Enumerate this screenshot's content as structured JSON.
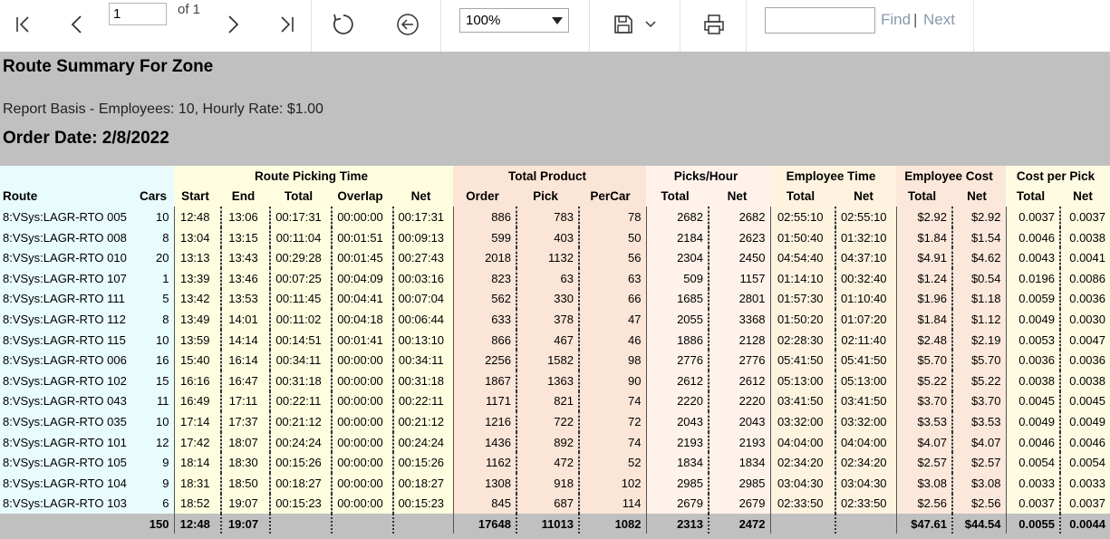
{
  "toolbar": {
    "page_value": "1",
    "of_label": "of 1",
    "zoom_value": "100%",
    "find_placeholder": "",
    "find_label": "Find",
    "separator": "|",
    "next_label": "Next",
    "icons": [
      "first-page-icon",
      "previous-page-icon",
      "next-page-icon",
      "last-page-icon",
      "refresh-icon",
      "back-icon",
      "chevron-down-icon",
      "save-icon",
      "print-icon"
    ]
  },
  "report": {
    "title": "Route Summary For  Zone",
    "basis": "Report Basis - Employees: 10, Hourly Rate: $1.00",
    "order_date": "Order Date: 2/8/2022",
    "group_headers": [
      "Route Picking Time",
      "Total Product",
      "Picks/Hour",
      "Employee Time",
      "Employee Cost",
      "Cost per Pick"
    ],
    "col_headers": [
      "Route",
      "Cars",
      "Start",
      "End",
      "Total",
      "Overlap",
      "Net",
      "Order",
      "Pick",
      "PerCar",
      "Total",
      "Net",
      "Total",
      "Net",
      "Total",
      "Net",
      "Total",
      "Net"
    ],
    "rows": [
      [
        "8:VSys:LAGR-RTO 005",
        "10",
        "12:48",
        "13:06",
        "00:17:31",
        "00:00:00",
        "00:17:31",
        "886",
        "783",
        "78",
        "2682",
        "2682",
        "02:55:10",
        "02:55:10",
        "$2.92",
        "$2.92",
        "0.0037",
        "0.0037"
      ],
      [
        "8:VSys:LAGR-RTO 008",
        "8",
        "13:04",
        "13:15",
        "00:11:04",
        "00:01:51",
        "00:09:13",
        "599",
        "403",
        "50",
        "2184",
        "2623",
        "01:50:40",
        "01:32:10",
        "$1.84",
        "$1.54",
        "0.0046",
        "0.0038"
      ],
      [
        "8:VSys:LAGR-RTO 010",
        "20",
        "13:13",
        "13:43",
        "00:29:28",
        "00:01:45",
        "00:27:43",
        "2018",
        "1132",
        "56",
        "2304",
        "2450",
        "04:54:40",
        "04:37:10",
        "$4.91",
        "$4.62",
        "0.0043",
        "0.0041"
      ],
      [
        "8:VSys:LAGR-RTO 107",
        "1",
        "13:39",
        "13:46",
        "00:07:25",
        "00:04:09",
        "00:03:16",
        "823",
        "63",
        "63",
        "509",
        "1157",
        "01:14:10",
        "00:32:40",
        "$1.24",
        "$0.54",
        "0.0196",
        "0.0086"
      ],
      [
        "8:VSys:LAGR-RTO 111",
        "5",
        "13:42",
        "13:53",
        "00:11:45",
        "00:04:41",
        "00:07:04",
        "562",
        "330",
        "66",
        "1685",
        "2801",
        "01:57:30",
        "01:10:40",
        "$1.96",
        "$1.18",
        "0.0059",
        "0.0036"
      ],
      [
        "8:VSys:LAGR-RTO 112",
        "8",
        "13:49",
        "14:01",
        "00:11:02",
        "00:04:18",
        "00:06:44",
        "633",
        "378",
        "47",
        "2055",
        "3368",
        "01:50:20",
        "01:07:20",
        "$1.84",
        "$1.12",
        "0.0049",
        "0.0030"
      ],
      [
        "8:VSys:LAGR-RTO 115",
        "10",
        "13:59",
        "14:14",
        "00:14:51",
        "00:01:41",
        "00:13:10",
        "866",
        "467",
        "46",
        "1886",
        "2128",
        "02:28:30",
        "02:11:40",
        "$2.48",
        "$2.19",
        "0.0053",
        "0.0047"
      ],
      [
        "8:VSys:LAGR-RTO 006",
        "16",
        "15:40",
        "16:14",
        "00:34:11",
        "00:00:00",
        "00:34:11",
        "2256",
        "1582",
        "98",
        "2776",
        "2776",
        "05:41:50",
        "05:41:50",
        "$5.70",
        "$5.70",
        "0.0036",
        "0.0036"
      ],
      [
        "8:VSys:LAGR-RTO 102",
        "15",
        "16:16",
        "16:47",
        "00:31:18",
        "00:00:00",
        "00:31:18",
        "1867",
        "1363",
        "90",
        "2612",
        "2612",
        "05:13:00",
        "05:13:00",
        "$5.22",
        "$5.22",
        "0.0038",
        "0.0038"
      ],
      [
        "8:VSys:LAGR-RTO 043",
        "11",
        "16:49",
        "17:11",
        "00:22:11",
        "00:00:00",
        "00:22:11",
        "1171",
        "821",
        "74",
        "2220",
        "2220",
        "03:41:50",
        "03:41:50",
        "$3.70",
        "$3.70",
        "0.0045",
        "0.0045"
      ],
      [
        "8:VSys:LAGR-RTO 035",
        "10",
        "17:14",
        "17:37",
        "00:21:12",
        "00:00:00",
        "00:21:12",
        "1216",
        "722",
        "72",
        "2043",
        "2043",
        "03:32:00",
        "03:32:00",
        "$3.53",
        "$3.53",
        "0.0049",
        "0.0049"
      ],
      [
        "8:VSys:LAGR-RTO 101",
        "12",
        "17:42",
        "18:07",
        "00:24:24",
        "00:00:00",
        "00:24:24",
        "1436",
        "892",
        "74",
        "2193",
        "2193",
        "04:04:00",
        "04:04:00",
        "$4.07",
        "$4.07",
        "0.0046",
        "0.0046"
      ],
      [
        "8:VSys:LAGR-RTO 105",
        "9",
        "18:14",
        "18:30",
        "00:15:26",
        "00:00:00",
        "00:15:26",
        "1162",
        "472",
        "52",
        "1834",
        "1834",
        "02:34:20",
        "02:34:20",
        "$2.57",
        "$2.57",
        "0.0054",
        "0.0054"
      ],
      [
        "8:VSys:LAGR-RTO 104",
        "9",
        "18:31",
        "18:50",
        "00:18:27",
        "00:00:00",
        "00:18:27",
        "1308",
        "918",
        "102",
        "2985",
        "2985",
        "03:04:30",
        "03:04:30",
        "$3.08",
        "$3.08",
        "0.0033",
        "0.0033"
      ],
      [
        "8:VSys:LAGR-RTO 103",
        "6",
        "18:52",
        "19:07",
        "00:15:23",
        "00:00:00",
        "00:15:23",
        "845",
        "687",
        "114",
        "2679",
        "2679",
        "02:33:50",
        "02:33:50",
        "$2.56",
        "$2.56",
        "0.0037",
        "0.0037"
      ]
    ],
    "totals": [
      "",
      "150",
      "12:48",
      "19:07",
      "",
      "",
      "",
      "17648",
      "11013",
      "1082",
      "2313",
      "2472",
      "",
      "",
      "$47.61",
      "$44.54",
      "0.0055",
      "0.0044"
    ]
  }
}
